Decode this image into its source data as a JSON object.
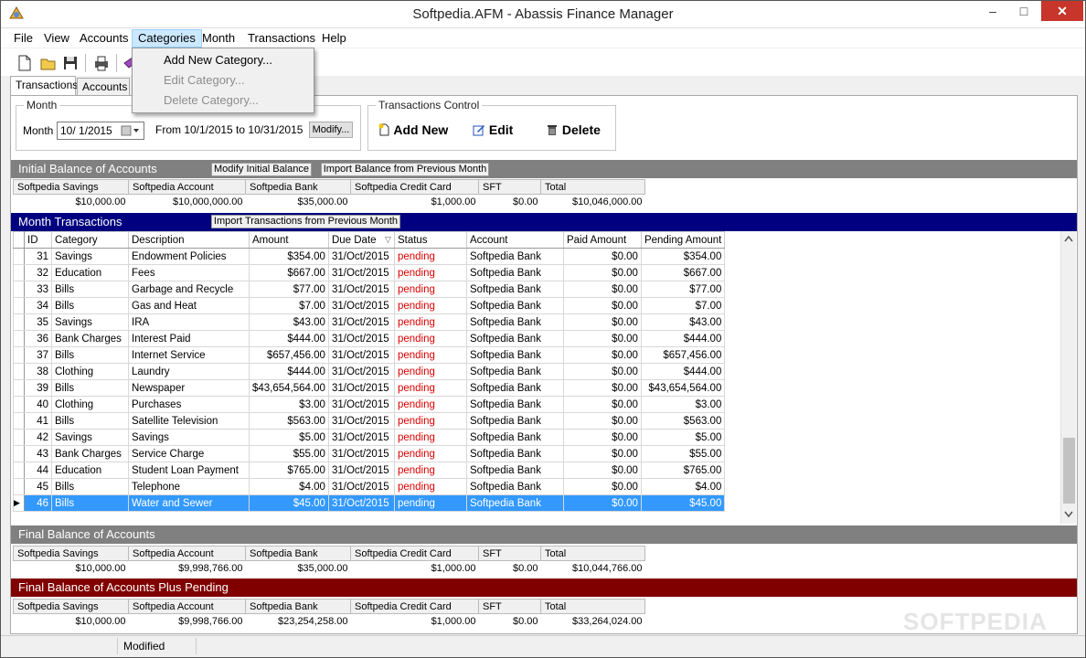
{
  "window": {
    "title": "Softpedia.AFM - Abassis Finance Manager",
    "minimize": "–",
    "maximize": "□",
    "close": "✕"
  },
  "menu": [
    "File",
    "View",
    "Accounts",
    "Categories",
    "Month",
    "Transactions",
    "Help"
  ],
  "categories_menu": {
    "add": "Add New Category...",
    "edit": "Edit Category...",
    "delete": "Delete Category..."
  },
  "tabs": {
    "transactions": "Transactions",
    "accounts": "Accounts"
  },
  "month_group": {
    "legend": "Month",
    "label": "Month",
    "value": "10/  1/2015",
    "range": "From 10/1/2015 to 10/31/2015",
    "modify": "Modify..."
  },
  "control_group": {
    "legend": "Transactions Control",
    "add_new": "Add New",
    "edit": "Edit",
    "delete": "Delete"
  },
  "initial": {
    "header": "Initial Balance of Accounts",
    "modify_btn": "Modify Initial Balance",
    "import_btn": "Import Balance from Previous Month",
    "columns": [
      "Softpedia Savings",
      "Softpedia Account",
      "Softpedia Bank",
      "Softpedia Credit Card",
      "SFT",
      "Total"
    ],
    "values": [
      "$10,000.00",
      "$10,000,000.00",
      "$35,000.00",
      "$1,000.00",
      "$0.00",
      "$10,046,000.00"
    ]
  },
  "month_tx": {
    "header": "Month Transactions",
    "import_btn": "Import Transactions from Previous Month",
    "columns": [
      "ID",
      "Category",
      "Description",
      "Amount",
      "Due Date",
      "Status",
      "Account",
      "Paid Amount",
      "Pending Amount"
    ],
    "rows": [
      [
        "31",
        "Savings",
        "Endowment Policies",
        "$354.00",
        "31/Oct/2015",
        "pending",
        "Softpedia Bank",
        "$0.00",
        "$354.00"
      ],
      [
        "32",
        "Education",
        "Fees",
        "$667.00",
        "31/Oct/2015",
        "pending",
        "Softpedia Bank",
        "$0.00",
        "$667.00"
      ],
      [
        "33",
        "Bills",
        "Garbage and Recycle",
        "$77.00",
        "31/Oct/2015",
        "pending",
        "Softpedia Bank",
        "$0.00",
        "$77.00"
      ],
      [
        "34",
        "Bills",
        "Gas and Heat",
        "$7.00",
        "31/Oct/2015",
        "pending",
        "Softpedia Bank",
        "$0.00",
        "$7.00"
      ],
      [
        "35",
        "Savings",
        "IRA",
        "$43.00",
        "31/Oct/2015",
        "pending",
        "Softpedia Bank",
        "$0.00",
        "$43.00"
      ],
      [
        "36",
        "Bank Charges",
        "Interest Paid",
        "$444.00",
        "31/Oct/2015",
        "pending",
        "Softpedia Bank",
        "$0.00",
        "$444.00"
      ],
      [
        "37",
        "Bills",
        "Internet Service",
        "$657,456.00",
        "31/Oct/2015",
        "pending",
        "Softpedia Bank",
        "$0.00",
        "$657,456.00"
      ],
      [
        "38",
        "Clothing",
        "Laundry",
        "$444.00",
        "31/Oct/2015",
        "pending",
        "Softpedia Bank",
        "$0.00",
        "$444.00"
      ],
      [
        "39",
        "Bills",
        "Newspaper",
        "$43,654,564.00",
        "31/Oct/2015",
        "pending",
        "Softpedia Bank",
        "$0.00",
        "$43,654,564.00"
      ],
      [
        "40",
        "Clothing",
        "Purchases",
        "$3.00",
        "31/Oct/2015",
        "pending",
        "Softpedia Bank",
        "$0.00",
        "$3.00"
      ],
      [
        "41",
        "Bills",
        "Satellite Television",
        "$563.00",
        "31/Oct/2015",
        "pending",
        "Softpedia Bank",
        "$0.00",
        "$563.00"
      ],
      [
        "42",
        "Savings",
        "Savings",
        "$5.00",
        "31/Oct/2015",
        "pending",
        "Softpedia Bank",
        "$0.00",
        "$5.00"
      ],
      [
        "43",
        "Bank Charges",
        "Service Charge",
        "$55.00",
        "31/Oct/2015",
        "pending",
        "Softpedia Bank",
        "$0.00",
        "$55.00"
      ],
      [
        "44",
        "Education",
        "Student Loan Payment",
        "$765.00",
        "31/Oct/2015",
        "pending",
        "Softpedia Bank",
        "$0.00",
        "$765.00"
      ],
      [
        "45",
        "Bills",
        "Telephone",
        "$4.00",
        "31/Oct/2015",
        "pending",
        "Softpedia Bank",
        "$0.00",
        "$4.00"
      ],
      [
        "46",
        "Bills",
        "Water and Sewer",
        "$45.00",
        "31/Oct/2015",
        "pending",
        "Softpedia Bank",
        "$0.00",
        "$45.00"
      ]
    ],
    "selected_id": "46"
  },
  "final": {
    "header": "Final Balance of Accounts",
    "columns": [
      "Softpedia Savings",
      "Softpedia Account",
      "Softpedia Bank",
      "Softpedia Credit Card",
      "SFT",
      "Total"
    ],
    "values": [
      "$10,000.00",
      "$9,998,766.00",
      "$35,000.00",
      "$1,000.00",
      "$0.00",
      "$10,044,766.00"
    ]
  },
  "final_pending": {
    "header": "Final Balance of Accounts Plus Pending",
    "columns": [
      "Softpedia Savings",
      "Softpedia Account",
      "Softpedia Bank",
      "Softpedia Credit Card",
      "SFT",
      "Total"
    ],
    "values": [
      "$10,000.00",
      "$9,998,766.00",
      "$23,254,258.00",
      "$1,000.00",
      "$0.00",
      "$33,264,024.00"
    ]
  },
  "status": {
    "state": "Modified"
  },
  "watermark": "SOFTPEDIA",
  "colors": {
    "gray_header": "#808080",
    "navy_header": "#000080",
    "maroon_header": "#800000",
    "selection": "#3399ff",
    "pending": "#dd0000"
  }
}
